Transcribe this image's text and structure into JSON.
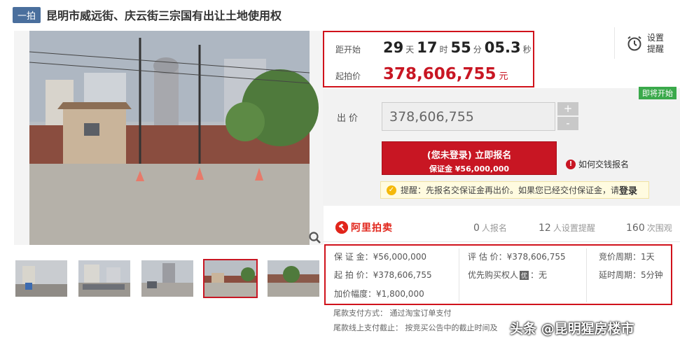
{
  "header": {
    "badge": "一拍",
    "title": "昆明市威远街、庆云街三宗国有出让土地使用权"
  },
  "countdown": {
    "label": "距开始",
    "days": "29",
    "days_unit": "天",
    "hours": "17",
    "hours_unit": "时",
    "minutes": "55",
    "minutes_unit": "分",
    "seconds": "05.3",
    "seconds_unit": "秒"
  },
  "start_price": {
    "label": "起拍价",
    "value": "378,606,755",
    "unit": "元"
  },
  "reminder": {
    "label": "设置提醒",
    "icon": "alarm-clock-icon"
  },
  "bid": {
    "status_tag": "即将开始",
    "label": "出价",
    "input_value": "378,606,755",
    "plus": "+",
    "minus": "-",
    "register_main": "(您未登录) 立即报名",
    "register_sub": "保证金 ¥56,000,000",
    "how_to_pay": "如何交钱报名",
    "tip_text": "提醒：先报名交保证金再出价。如果您已经交付保证金，请",
    "tip_login": "登录"
  },
  "stats": {
    "brand": "阿里拍卖",
    "signups": "0",
    "signups_label": "人报名",
    "reminders": "12",
    "reminders_label": "人设置提醒",
    "views": "160",
    "views_label": "次围观"
  },
  "info": {
    "deposit": "保 证 金：¥56,000,000",
    "start_price": "起 拍 价：¥378,606,755",
    "increment": "加价幅度：¥1,800,000",
    "assessed": "评 估 价：¥378,606,755",
    "priority_label": "优先购买权人",
    "priority_badge": "优",
    "priority_value": "：无",
    "cycle": "竞价周期：1天",
    "delay": "延时周期：5分钟"
  },
  "footer": {
    "payment_method": "尾款支付方式：   通过淘宝订单支付",
    "payment_deadline": "尾款线上支付截止：  按竞买公告中的截止时间及"
  },
  "watermark": "头条 @昆明猩房楼市",
  "colors": {
    "accent_red": "#c81623",
    "badge_blue": "#4a6f9d",
    "tag_green": "#3aa94b"
  }
}
